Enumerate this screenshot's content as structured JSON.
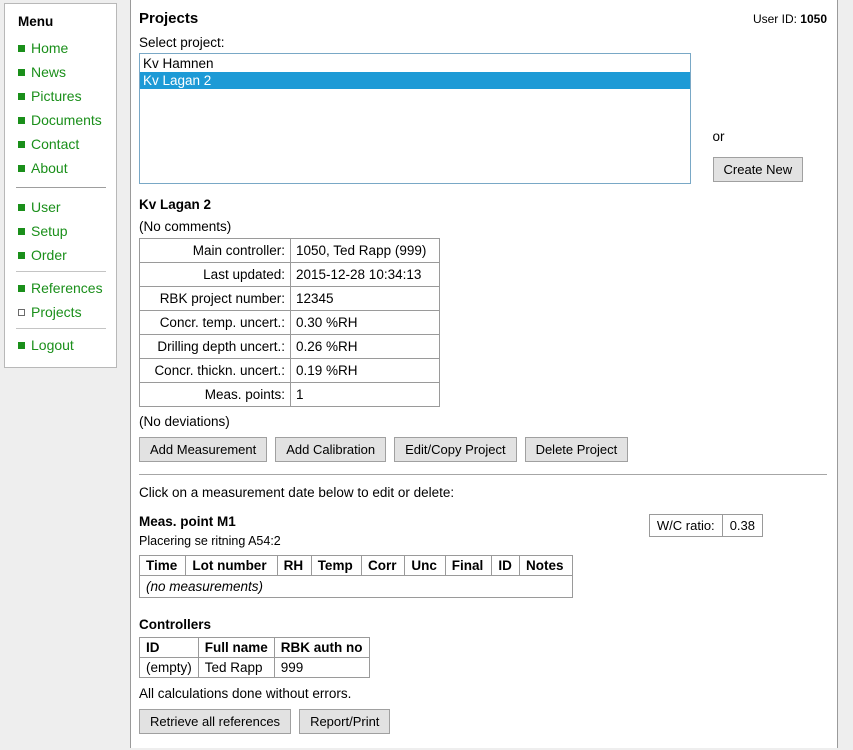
{
  "sidebar": {
    "title": "Menu",
    "groups": [
      {
        "items": [
          {
            "label": "Home",
            "bullet": "filled-square-icon"
          },
          {
            "label": "News",
            "bullet": "filled-square-icon"
          },
          {
            "label": "Pictures",
            "bullet": "filled-square-icon"
          },
          {
            "label": "Documents",
            "bullet": "filled-square-icon"
          },
          {
            "label": "Contact",
            "bullet": "filled-square-icon"
          },
          {
            "label": "About",
            "bullet": "filled-square-icon"
          }
        ]
      },
      {
        "items": [
          {
            "label": "User",
            "bullet": "filled-square-icon"
          },
          {
            "label": "Setup",
            "bullet": "filled-square-icon"
          },
          {
            "label": "Order",
            "bullet": "filled-square-icon"
          }
        ]
      },
      {
        "items": [
          {
            "label": "References",
            "bullet": "filled-square-icon"
          },
          {
            "label": "Projects",
            "bullet": "hollow-square-icon"
          }
        ]
      },
      {
        "items": [
          {
            "label": "Logout",
            "bullet": "filled-square-icon"
          }
        ]
      }
    ],
    "link_color": "#1a8f1a"
  },
  "header": {
    "title": "Projects",
    "user_id_label": "User ID:",
    "user_id_value": "1050"
  },
  "select_project": {
    "label": "Select project:",
    "options": [
      {
        "label": "Kv Hamnen",
        "selected": false
      },
      {
        "label": "Kv Lagan 2",
        "selected": true
      }
    ],
    "selected_value": "Kv Lagan 2",
    "or_text": "or",
    "create_new_label": "Create New",
    "highlight_color": "#1d9ad6"
  },
  "project": {
    "name": "Kv Lagan 2",
    "comments": "(No comments)",
    "deviations": "(No deviations)",
    "details": [
      {
        "key": "Main controller:",
        "value": "1050, Ted Rapp (999)"
      },
      {
        "key": "Last updated:",
        "value": "2015-12-28 10:34:13"
      },
      {
        "key": "RBK project number:",
        "value": "12345"
      },
      {
        "key": "Concr. temp. uncert.:",
        "value": "0.30 %RH"
      },
      {
        "key": "Drilling depth uncert.:",
        "value": "0.26 %RH"
      },
      {
        "key": "Concr. thickn. uncert.:",
        "value": "0.19 %RH"
      },
      {
        "key": "Meas. points:",
        "value": "1"
      }
    ],
    "actions": [
      "Add Measurement",
      "Add Calibration",
      "Edit/Copy Project",
      "Delete Project"
    ]
  },
  "measurements": {
    "hint": "Click on a measurement date below to edit or delete:",
    "point_title": "Meas. point M1",
    "point_subtitle": "Placering se ritning A54:2",
    "wc_label": "W/C ratio:",
    "wc_value": "0.38",
    "columns": [
      "Time",
      "Lot number",
      "RH",
      "Temp",
      "Corr",
      "Unc",
      "Final",
      "ID",
      "Notes"
    ],
    "empty_text": "(no measurements)"
  },
  "controllers": {
    "title": "Controllers",
    "columns": [
      "ID",
      "Full name",
      "RBK auth no"
    ],
    "rows": [
      {
        "id": "(empty)",
        "full_name": "Ted Rapp",
        "rbk_auth_no": "999"
      }
    ]
  },
  "footer": {
    "status": "All calculations done without errors.",
    "buttons": [
      "Retrieve all references",
      "Report/Print"
    ]
  }
}
